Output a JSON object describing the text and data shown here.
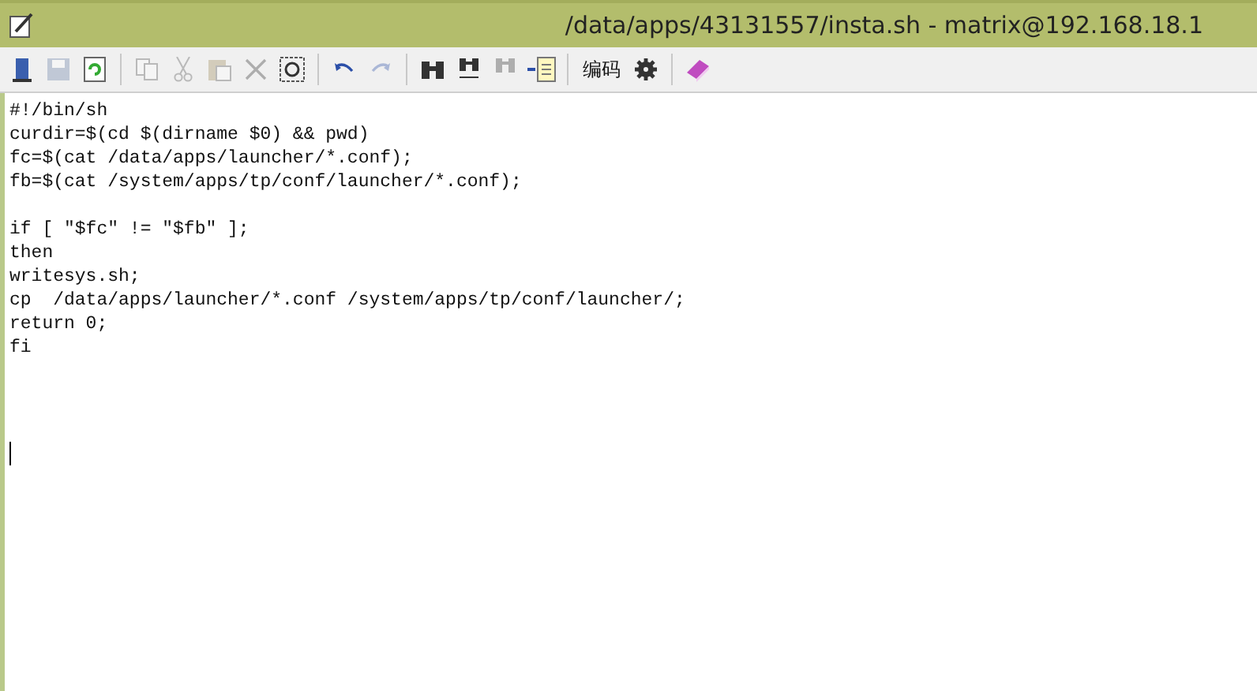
{
  "window": {
    "title": "/data/apps/43131557/insta.sh - matrix@192.168.18.1"
  },
  "toolbar": [
    {
      "kind": "exit",
      "disabled": false
    },
    {
      "kind": "save",
      "disabled": true
    },
    {
      "kind": "reload",
      "disabled": false
    },
    {
      "kind": "separator"
    },
    {
      "kind": "copy",
      "disabled": true
    },
    {
      "kind": "cut",
      "disabled": true
    },
    {
      "kind": "paste",
      "disabled": true
    },
    {
      "kind": "delete",
      "disabled": true
    },
    {
      "kind": "select-all",
      "disabled": false
    },
    {
      "kind": "separator"
    },
    {
      "kind": "undo",
      "disabled": false
    },
    {
      "kind": "redo",
      "disabled": true
    },
    {
      "kind": "separator"
    },
    {
      "kind": "find",
      "disabled": false
    },
    {
      "kind": "replace",
      "disabled": false
    },
    {
      "kind": "find-next",
      "disabled": true
    },
    {
      "kind": "goto",
      "disabled": false
    },
    {
      "kind": "separator"
    },
    {
      "kind": "text",
      "label": "编码",
      "disabled": false
    },
    {
      "kind": "settings",
      "disabled": false
    },
    {
      "kind": "separator"
    },
    {
      "kind": "help",
      "disabled": false
    }
  ],
  "editor": {
    "lines": [
      {
        "kind": "code",
        "text": "#!/bin/sh"
      },
      {
        "kind": "code",
        "text": "curdir=$(cd $(dirname $0) && pwd)"
      },
      {
        "kind": "code",
        "text": "fc=$(cat /data/apps/launcher/*.conf);"
      },
      {
        "kind": "code",
        "text": "fb=$(cat /system/apps/tp/conf/launcher/*.conf);"
      },
      {
        "kind": "blank"
      },
      {
        "kind": "code",
        "text": "if [ \"$fc\" != \"$fb\" ];"
      },
      {
        "kind": "code",
        "text": "then"
      },
      {
        "kind": "code",
        "text": "writesys.sh;"
      },
      {
        "kind": "code",
        "text": "cp  /data/apps/launcher/*.conf /system/apps/tp/conf/launcher/;"
      },
      {
        "kind": "code",
        "text": "return 0;"
      },
      {
        "kind": "code",
        "text": "fi"
      }
    ],
    "cursor": true
  }
}
